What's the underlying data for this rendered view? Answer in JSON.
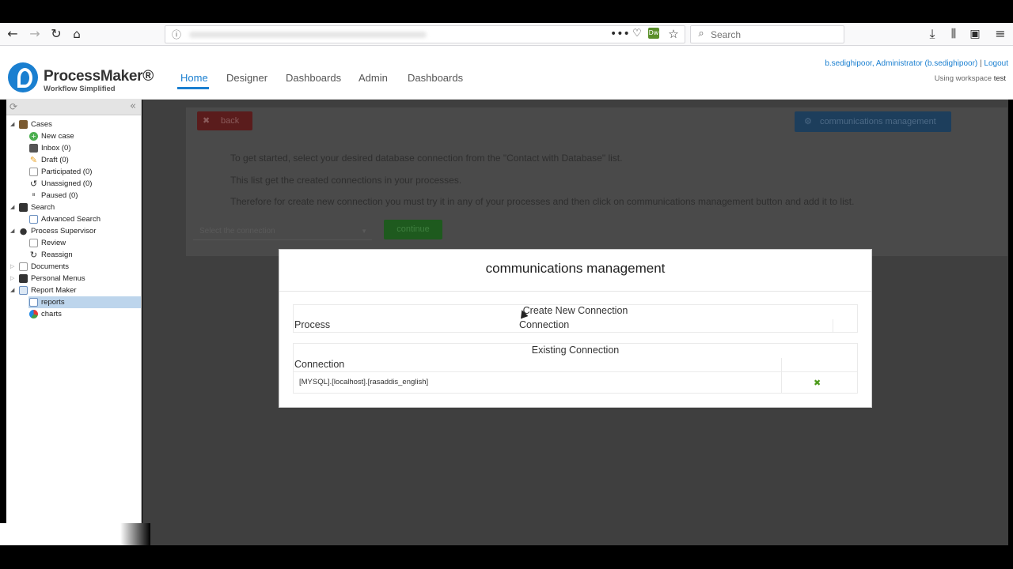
{
  "browser": {
    "search_placeholder": "Search",
    "icons": [
      "back-icon",
      "forward-icon",
      "reload-icon",
      "home-icon",
      "info-icon",
      "more-icon",
      "pocket-icon",
      "extension-icon",
      "bookmark-star-icon",
      "search-icon",
      "download-icon",
      "library-icon",
      "sidebar-icon",
      "menu-icon"
    ]
  },
  "header": {
    "logo_name": "ProcessMaker®",
    "logo_tagline": "Workflow Simplified",
    "nav": [
      "Home",
      "Designer",
      "Dashboards",
      "Admin",
      "Dashboards"
    ],
    "user": "b.sedighipoor, Administrator (b.sedighipoor)",
    "separator": "|",
    "logout": "Logout",
    "workspace_prefix": "Using workspace",
    "workspace": "test",
    "accent": "#1a7fd0"
  },
  "sidebar": {
    "cases": "Cases",
    "new_case": "New case",
    "inbox": "Inbox (0)",
    "draft": "Draft (0)",
    "participated": "Participated (0)",
    "unassigned": "Unassigned (0)",
    "paused": "Paused (0)",
    "search": "Search",
    "advanced_search": "Advanced Search",
    "process_supervisor": "Process Supervisor",
    "review": "Review",
    "reassign": "Reassign",
    "documents": "Documents",
    "personal_menus": "Personal Menus",
    "report_maker": "Report Maker",
    "reports": "reports",
    "charts": "charts"
  },
  "main": {
    "back_label": "back",
    "comm_label": "communications management",
    "info_1": "To get started, select your desired database connection from the \"Contact with Database\" list.",
    "info_2": "This list get the created connections in your processes.",
    "info_3": "Therefore for create new connection you must try it in any of your processes and then click on communications management button and add it to list.",
    "select_placeholder": "Select the connection",
    "continue_label": "continue"
  },
  "modal": {
    "title": "communications management",
    "create_header": "Create New Connection",
    "col_process": "Process",
    "col_connection": "Connection",
    "existing_header": "Existing Connection",
    "col_existing_connection": "Connection",
    "rows": [
      {
        "connection": "[MYSQL].[localhost].[rasaddis_english]"
      }
    ],
    "delete_icon": "✖"
  }
}
